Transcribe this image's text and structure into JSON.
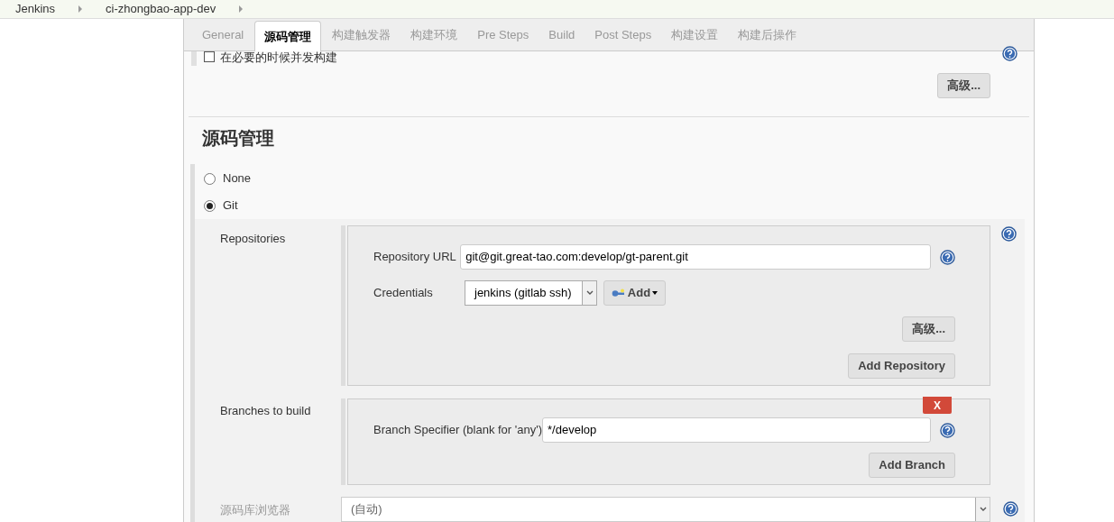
{
  "breadcrumbs": [
    "Jenkins",
    "ci-zhongbao-app-dev"
  ],
  "tabs": [
    {
      "label": "General",
      "selected": false
    },
    {
      "label": "源码管理",
      "selected": true
    },
    {
      "label": "构建触发器",
      "selected": false
    },
    {
      "label": "构建环境",
      "selected": false
    },
    {
      "label": "Pre Steps",
      "selected": false
    },
    {
      "label": "Build",
      "selected": false
    },
    {
      "label": "Post Steps",
      "selected": false
    },
    {
      "label": "构建设置",
      "selected": false
    },
    {
      "label": "构建后操作",
      "selected": false
    }
  ],
  "concurrent_build": {
    "label": "在必要的时候并发构建",
    "checked": false
  },
  "advanced_button": "高级...",
  "section_title": "源码管理",
  "scm_options": [
    {
      "label": "None",
      "selected": false
    },
    {
      "label": "Git",
      "selected": true
    }
  ],
  "repositories": {
    "label": "Repositories",
    "url_label": "Repository URL",
    "url": "git@git.great-tao.com:develop/gt-parent.git",
    "credentials_label": "Credentials",
    "credentials": "jenkins (gitlab ssh)",
    "add_button": "Add",
    "advanced_button": "高级...",
    "add_repository_button": "Add Repository"
  },
  "branches": {
    "label": "Branches to build",
    "delete_button": "X",
    "specifier_label": "Branch Specifier (blank for 'any')",
    "specifier": "*/develop",
    "add_branch_button": "Add Branch"
  },
  "repository_browser": {
    "label": "源码库浏览器",
    "value": "(自动)"
  }
}
